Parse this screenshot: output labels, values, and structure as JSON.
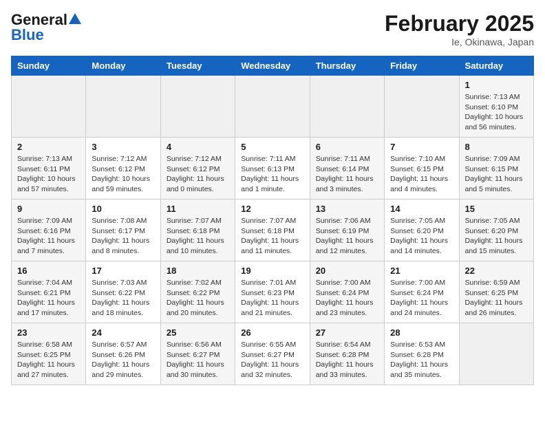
{
  "header": {
    "logo_general": "General",
    "logo_blue": "Blue",
    "main_title": "February 2025",
    "subtitle": "Ie, Okinawa, Japan"
  },
  "days_of_week": [
    "Sunday",
    "Monday",
    "Tuesday",
    "Wednesday",
    "Thursday",
    "Friday",
    "Saturday"
  ],
  "weeks": [
    [
      {
        "day": "",
        "info": ""
      },
      {
        "day": "",
        "info": ""
      },
      {
        "day": "",
        "info": ""
      },
      {
        "day": "",
        "info": ""
      },
      {
        "day": "",
        "info": ""
      },
      {
        "day": "",
        "info": ""
      },
      {
        "day": "1",
        "info": "Sunrise: 7:13 AM\nSunset: 6:10 PM\nDaylight: 10 hours\nand 56 minutes."
      }
    ],
    [
      {
        "day": "2",
        "info": "Sunrise: 7:13 AM\nSunset: 6:11 PM\nDaylight: 10 hours\nand 57 minutes."
      },
      {
        "day": "3",
        "info": "Sunrise: 7:12 AM\nSunset: 6:12 PM\nDaylight: 10 hours\nand 59 minutes."
      },
      {
        "day": "4",
        "info": "Sunrise: 7:12 AM\nSunset: 6:12 PM\nDaylight: 11 hours\nand 0 minutes."
      },
      {
        "day": "5",
        "info": "Sunrise: 7:11 AM\nSunset: 6:13 PM\nDaylight: 11 hours\nand 1 minute."
      },
      {
        "day": "6",
        "info": "Sunrise: 7:11 AM\nSunset: 6:14 PM\nDaylight: 11 hours\nand 3 minutes."
      },
      {
        "day": "7",
        "info": "Sunrise: 7:10 AM\nSunset: 6:15 PM\nDaylight: 11 hours\nand 4 minutes."
      },
      {
        "day": "8",
        "info": "Sunrise: 7:09 AM\nSunset: 6:15 PM\nDaylight: 11 hours\nand 5 minutes."
      }
    ],
    [
      {
        "day": "9",
        "info": "Sunrise: 7:09 AM\nSunset: 6:16 PM\nDaylight: 11 hours\nand 7 minutes."
      },
      {
        "day": "10",
        "info": "Sunrise: 7:08 AM\nSunset: 6:17 PM\nDaylight: 11 hours\nand 8 minutes."
      },
      {
        "day": "11",
        "info": "Sunrise: 7:07 AM\nSunset: 6:18 PM\nDaylight: 11 hours\nand 10 minutes."
      },
      {
        "day": "12",
        "info": "Sunrise: 7:07 AM\nSunset: 6:18 PM\nDaylight: 11 hours\nand 11 minutes."
      },
      {
        "day": "13",
        "info": "Sunrise: 7:06 AM\nSunset: 6:19 PM\nDaylight: 11 hours\nand 12 minutes."
      },
      {
        "day": "14",
        "info": "Sunrise: 7:05 AM\nSunset: 6:20 PM\nDaylight: 11 hours\nand 14 minutes."
      },
      {
        "day": "15",
        "info": "Sunrise: 7:05 AM\nSunset: 6:20 PM\nDaylight: 11 hours\nand 15 minutes."
      }
    ],
    [
      {
        "day": "16",
        "info": "Sunrise: 7:04 AM\nSunset: 6:21 PM\nDaylight: 11 hours\nand 17 minutes."
      },
      {
        "day": "17",
        "info": "Sunrise: 7:03 AM\nSunset: 6:22 PM\nDaylight: 11 hours\nand 18 minutes."
      },
      {
        "day": "18",
        "info": "Sunrise: 7:02 AM\nSunset: 6:22 PM\nDaylight: 11 hours\nand 20 minutes."
      },
      {
        "day": "19",
        "info": "Sunrise: 7:01 AM\nSunset: 6:23 PM\nDaylight: 11 hours\nand 21 minutes."
      },
      {
        "day": "20",
        "info": "Sunrise: 7:00 AM\nSunset: 6:24 PM\nDaylight: 11 hours\nand 23 minutes."
      },
      {
        "day": "21",
        "info": "Sunrise: 7:00 AM\nSunset: 6:24 PM\nDaylight: 11 hours\nand 24 minutes."
      },
      {
        "day": "22",
        "info": "Sunrise: 6:59 AM\nSunset: 6:25 PM\nDaylight: 11 hours\nand 26 minutes."
      }
    ],
    [
      {
        "day": "23",
        "info": "Sunrise: 6:58 AM\nSunset: 6:25 PM\nDaylight: 11 hours\nand 27 minutes."
      },
      {
        "day": "24",
        "info": "Sunrise: 6:57 AM\nSunset: 6:26 PM\nDaylight: 11 hours\nand 29 minutes."
      },
      {
        "day": "25",
        "info": "Sunrise: 6:56 AM\nSunset: 6:27 PM\nDaylight: 11 hours\nand 30 minutes."
      },
      {
        "day": "26",
        "info": "Sunrise: 6:55 AM\nSunset: 6:27 PM\nDaylight: 11 hours\nand 32 minutes."
      },
      {
        "day": "27",
        "info": "Sunrise: 6:54 AM\nSunset: 6:28 PM\nDaylight: 11 hours\nand 33 minutes."
      },
      {
        "day": "28",
        "info": "Sunrise: 6:53 AM\nSunset: 6:28 PM\nDaylight: 11 hours\nand 35 minutes."
      },
      {
        "day": "",
        "info": ""
      }
    ]
  ]
}
